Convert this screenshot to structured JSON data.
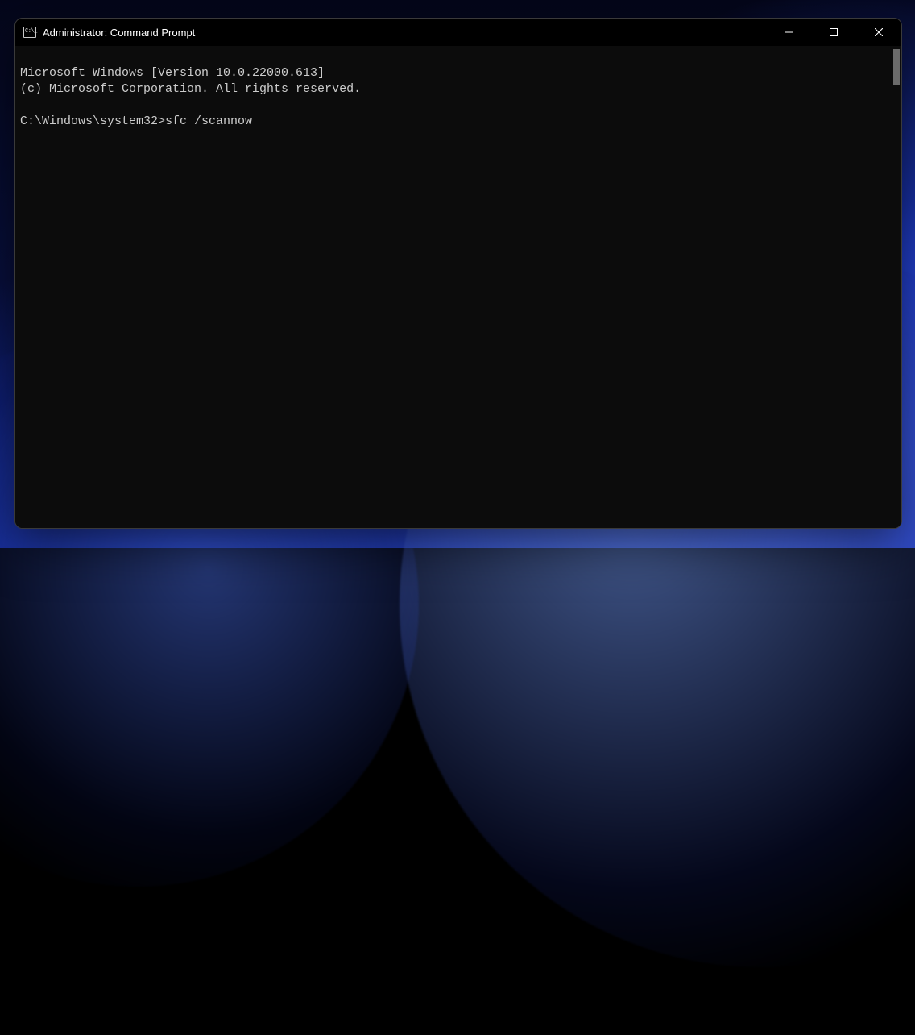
{
  "window": {
    "title": "Administrator: Command Prompt"
  },
  "terminal": {
    "line1": "Microsoft Windows [Version 10.0.22000.613]",
    "line2": "(c) Microsoft Corporation. All rights reserved.",
    "blank": "",
    "prompt": "C:\\Windows\\system32>",
    "command": "sfc /scannow"
  }
}
